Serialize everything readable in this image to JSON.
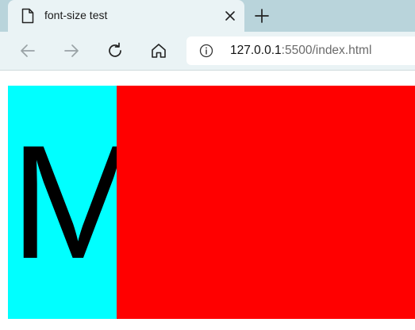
{
  "browser": {
    "tab": {
      "title": "font-size test",
      "icon": "page-icon"
    },
    "toolbar": {
      "address": {
        "host": "127.0.0.1",
        "rest": ":5500/index.html"
      }
    }
  },
  "page": {
    "glyph": "M",
    "colors": {
      "left_block": "#00ffff",
      "right_block": "#ff0000",
      "text": "#000000"
    }
  }
}
